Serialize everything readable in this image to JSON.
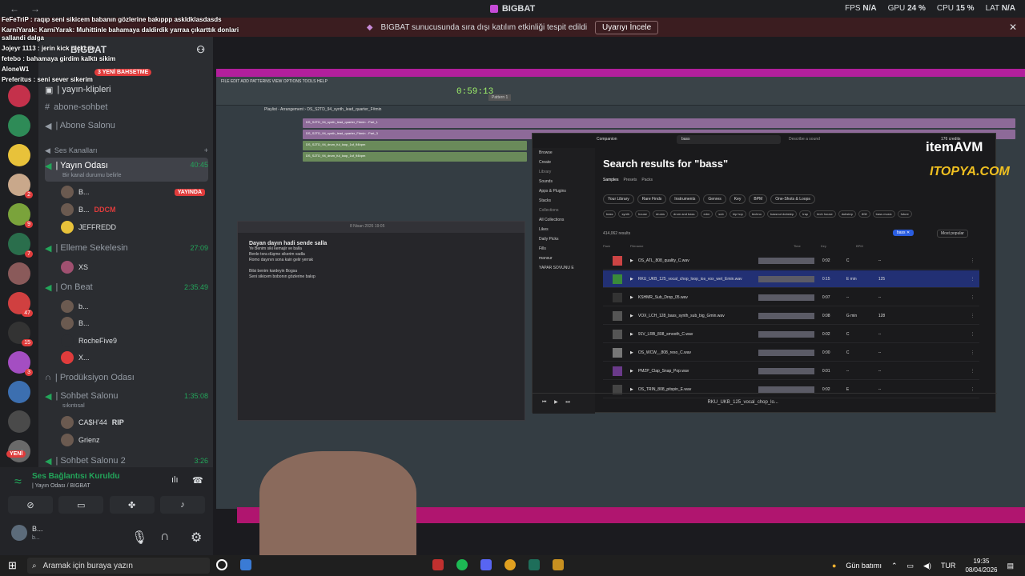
{
  "titlebar": {
    "title": "BIGBAT",
    "back": "←",
    "forward": "→",
    "fps_label": "FPS",
    "fps": "N/A",
    "gpu_label": "GPU",
    "gpu": "24 %",
    "cpu_label": "CPU",
    "cpu": "15 %",
    "lat_label": "LAT",
    "lat": "N/A"
  },
  "banner": {
    "text": "BIGBAT sunucusunda sıra dışı katılım etkinliği tespit edildi",
    "button": "Uyarıyı İncele",
    "close": "✕"
  },
  "server": {
    "name": "BIGBAT"
  },
  "overlay_chat": [
    "FeFeTriP : raqıp seni sikicem babanın gözlerine bakıppp askldklasdasds",
    "KarniYarak: KarniYarak: Muhittinle bahamaya daldirdik yarraa çıkarttık donlari sallandi dalga",
    "Jojeyr 1113 : jerin kick nicki ne",
    "fetebo : bahamaya girdim kalktı sikim",
    "AloneW1",
    "Preferitus : seni sever sikerim"
  ],
  "badges": {
    "events": "3 YENİ BAHSETME",
    "new": "YENİ"
  },
  "channels": {
    "klip": "| yayın-klipleri",
    "sohbet": "abone-sohbet",
    "abone_salonu": "| Abone Salonu",
    "category": "Ses Kanalları",
    "yayin_odasi": "| Yayın Odası",
    "yayin_time": "40:45",
    "yayin_status": "Bir kanal durumu belirle",
    "users1": [
      "B...",
      "B...",
      "JEFFREDD"
    ],
    "live": "YAYINDA",
    "ddcm": "DDCM",
    "elleme": "| Elleme Sekelesin",
    "elleme_time": "27:09",
    "elleme_user": "XS",
    "onbeat": "| On Beat",
    "onbeat_time": "2:35:49",
    "onbeat_users": [
      "b...",
      "B...",
      "RocheFive9",
      "X..."
    ],
    "produksiyon": "| Prodüksiyon Odası",
    "sohbet_salonu": "| Sohbet Salonu",
    "sohbet_time": "1:35:08",
    "sohbet_sub": "sıkıntısal",
    "sohbet_users": [
      "CA$H'44",
      "Grienz"
    ],
    "rip": "RIP",
    "sohbet2": "| Sohbet Salonu 2",
    "sohbet2_time": "3:26"
  },
  "voice": {
    "status": "Ses Bağlantısı Kuruldu",
    "location": "| Yayın Odası / BIGBAT",
    "user": "B...",
    "user_sub": "b..."
  },
  "daw": {
    "time": "0:59:13",
    "pattern": "Pattern 1",
    "playlist": "Playlist - Arrangement › DS_S2TD_94_synth_lead_quarter_F#min",
    "tracks": [
      "DS_S2TD_94_synth_lead_quarter_F#min - Part_1",
      "DS_S2TD_94_synth_lead_quarter_F#min - Part_3",
      "DS_S2TD_94_drum_ful_loop_1sf_94bpm",
      "DS_S2TD_94_drum_ful_loop_1sf_94bpm"
    ],
    "menu": "FILE EDIT ADD PATTERNS VIEW OPTIONS TOOLS HELP"
  },
  "note": {
    "date": "8 Nisan 2026 19:05",
    "title": "Dayan dayın hadi sende salla",
    "lines": [
      "Ye Benim siki kemajir ve balla",
      "Benle tora düşme sikerim vadla",
      "Romo dayının sona kain gelir yerrak",
      "",
      "Bilsi benim kardeyin Bogsa",
      "Seni sikicem bobonın gözlerine bakıp"
    ]
  },
  "splice": {
    "credits": "176 credits",
    "search_value": "bass",
    "search_hint": "Describe a sound",
    "heading": "Search results for \"bass\"",
    "tabs": [
      "Samples",
      "Presets",
      "Packs"
    ],
    "nav": [
      "Browse",
      "Create",
      "Library",
      "Sounds",
      "Apps & Plugins",
      "Stacks",
      "Collections",
      "All Collections",
      "Likes",
      "Daily Picks",
      "Fills",
      "mansur",
      "YAPAR SOVUNU E"
    ],
    "filters": [
      "Your Library",
      "Rare Finds",
      "Instruments",
      "Genres",
      "Key",
      "BPM",
      "One-Shots & Loops"
    ],
    "tags": [
      "bass",
      "synth",
      "house",
      "drums",
      "drum and bass",
      "edm",
      "sub",
      "hip hop",
      "techno",
      "bassnut dubstep",
      "trap",
      "tech house",
      "dubstep",
      "808",
      "bass music",
      "future"
    ],
    "count": "414,062 results",
    "chip": "bass ✕",
    "sort": "Most popular",
    "columns": [
      "Pack",
      "Filename",
      "Time",
      "Key",
      "BPM"
    ],
    "rows": [
      {
        "name": "OS_ATL_808_quality_C.wav",
        "time": "0:02",
        "key": "C",
        "bpm": "--"
      },
      {
        "name": "RKU_UKB_125_vocal_chop_loop_ios_vox_wet_Emin.wav",
        "time": "0:15",
        "key": "E min",
        "bpm": "125"
      },
      {
        "name": "KSHMR_Sub_Drop_05.wav",
        "time": "0:07",
        "key": "--",
        "bpm": "--"
      },
      {
        "name": "VOX_LCH_128_bass_synth_sub_big_Gmin.wav",
        "time": "0:08",
        "key": "G min",
        "bpm": "128"
      },
      {
        "name": "91V_LRB_808_smooth_C.wav",
        "time": "0:02",
        "key": "C",
        "bpm": "--"
      },
      {
        "name": "OS_WCW__808_reso_C.wav",
        "time": "0:00",
        "key": "C",
        "bpm": "--"
      },
      {
        "name": "PMZP_Clap_Snap_Pop.wav",
        "time": "0:01",
        "key": "--",
        "bpm": "--"
      },
      {
        "name": "OS_TRIN_808_pitspin_E.wav",
        "time": "0:02",
        "key": "E",
        "bpm": "--"
      }
    ],
    "player_track": "RKU_UKB_125_vocal_chop_lo..."
  },
  "sponsors": {
    "itemavm": "itemAVM",
    "itopya": "ITOPYA.COM"
  },
  "taskbar": {
    "search": "Aramak için buraya yazın",
    "weather": "Gün batımı",
    "lang": "TUR",
    "time": "19:35",
    "date": "08/04/2026"
  },
  "colors": {
    "discord_bg": "#1e1f22",
    "discord_panel": "#2b2d31",
    "green": "#23a55a",
    "red": "#e03c3c",
    "magenta": "#b21f9c",
    "splice_blue": "#223074"
  }
}
